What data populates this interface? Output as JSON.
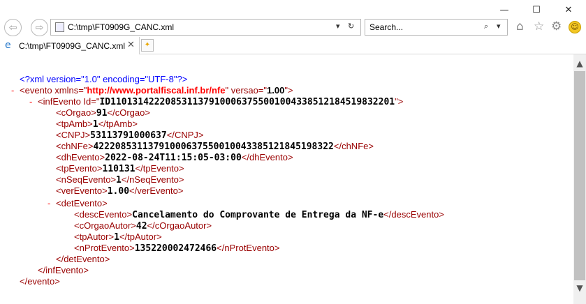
{
  "window": {
    "minimize_glyph": "—",
    "maximize_glyph": "☐",
    "close_glyph": "✕"
  },
  "nav": {
    "back_glyph": "⇦",
    "forward_glyph": "⇨",
    "address": "C:\\tmp\\FT0909G_CANC.xml",
    "address_dropdown_glyph": "▾",
    "refresh_glyph": "↻",
    "search_placeholder": "Search...",
    "search_button_glyph": "⌕",
    "search_dropdown_glyph": "▾",
    "home_glyph": "⌂",
    "favorites_glyph": "☆",
    "settings_glyph": "⚙",
    "feedback_glyph": "☺"
  },
  "tab": {
    "icon_glyph": "e",
    "title": "C:\\tmp\\FT0909G_CANC.xml",
    "close_glyph": "✕",
    "newtab_glyph": "✦"
  },
  "xml": {
    "collapse_glyph": "-",
    "decl": "<?xml version=\"1.0\" encoding=\"UTF-8\"?>",
    "evento_open_tag": "<evento",
    "evento_xmlns_name": "xmlns=\"",
    "evento_xmlns_value": "http://www.portalfiscal.inf.br/nfe",
    "evento_versao_name": "\" versao=\"",
    "evento_versao_value": "1.00",
    "evento_open_close": "\">",
    "infEvento_open": "<infEvento Id=\"",
    "infEvento_id": "ID1101314222085311379100063755001004338512184519832201",
    "infEvento_close": "\">",
    "elements": [
      {
        "name": "cOrgao",
        "value": "91"
      },
      {
        "name": "tpAmb",
        "value": "1"
      },
      {
        "name": "CNPJ",
        "value": "53113791000637"
      },
      {
        "name": "chNFe",
        "value": "42220853113791000637550010043385121845198322"
      },
      {
        "name": "dhEvento",
        "value": "2022-08-24T11:15:05-03:00"
      },
      {
        "name": "tpEvento",
        "value": "110131"
      },
      {
        "name": "nSeqEvento",
        "value": "1"
      },
      {
        "name": "verEvento",
        "value": "1.00"
      }
    ],
    "detEvento_open": "<detEvento>",
    "detElements": [
      {
        "name": "descEvento",
        "value": "Cancelamento do Comprovante de Entrega da NF-e"
      },
      {
        "name": "cOrgaoAutor",
        "value": "42"
      },
      {
        "name": "tpAutor",
        "value": "1"
      },
      {
        "name": "nProtEvento",
        "value": "135220002472466"
      }
    ],
    "detEvento_close": "</detEvento>",
    "infEvento_end": "</infEvento>",
    "evento_end": "</evento>"
  },
  "scrollbar": {
    "up_glyph": "▲",
    "down_glyph": "▼"
  }
}
